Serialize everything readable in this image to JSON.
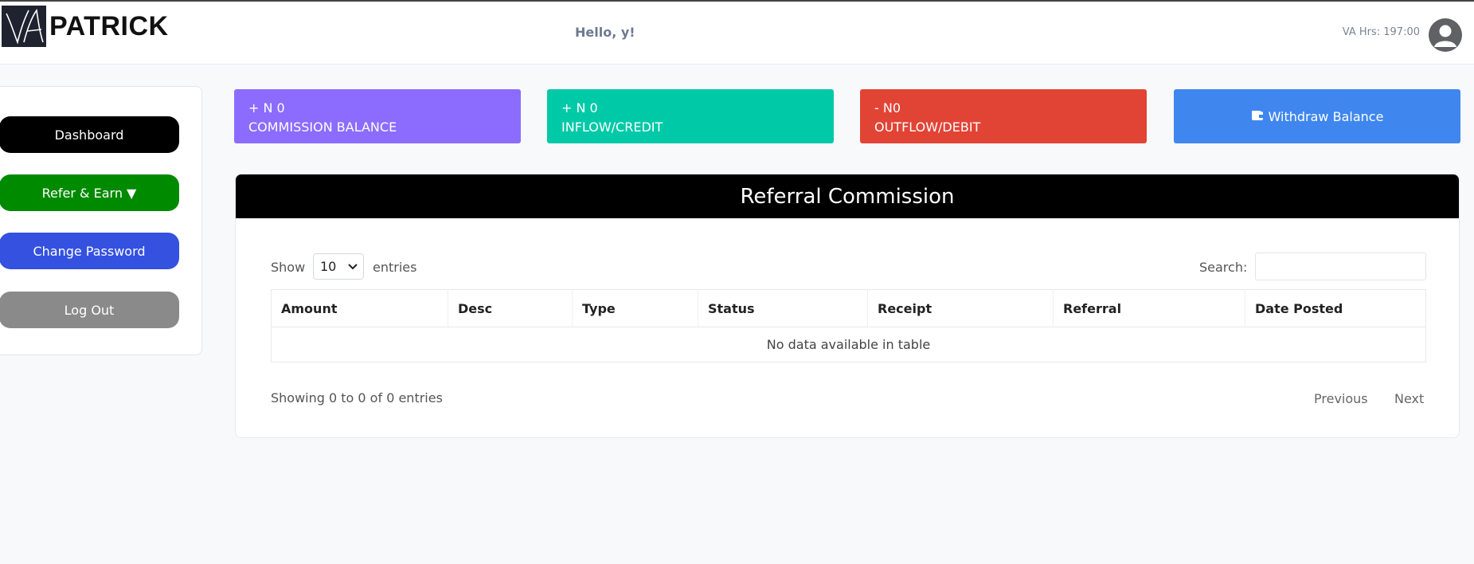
{
  "header": {
    "brand": "PATRICK",
    "logo_text": "VA",
    "greeting": "Hello, y!",
    "va_hours": "VA Hrs: 197:00",
    "avatar_icon": "user-avatar-icon"
  },
  "sidebar": {
    "items": [
      {
        "label": "Dashboard",
        "color": "#000000"
      },
      {
        "label": "Refer & Earn ▼",
        "color": "#008a00"
      },
      {
        "label": "Change Password",
        "color": "#3451e0"
      },
      {
        "label": "Log Out",
        "color": "#8a8a8a"
      }
    ]
  },
  "stats": [
    {
      "value": "+ N 0",
      "label": "COMMISSION BALANCE",
      "color": "#8b6cff"
    },
    {
      "value": "+ N 0",
      "label": "INFLOW/CREDIT",
      "color": "#00c9a7"
    },
    {
      "value": "- N0",
      "label": "OUTFLOW/DEBIT",
      "color": "#e14435"
    }
  ],
  "withdraw": {
    "label": "Withdraw Balance",
    "icon": "wallet-icon",
    "color": "#3f87ef"
  },
  "panel": {
    "title": "Referral Commission",
    "show_label": "Show",
    "entries_value": "10",
    "entries_label": "entries",
    "search_label": "Search:",
    "search_value": "",
    "columns": [
      "Amount",
      "Desc",
      "Type",
      "Status",
      "Receipt",
      "Referral",
      "Date Posted"
    ],
    "empty_message": "No data available in table",
    "info": "Showing 0 to 0 of 0 entries",
    "previous": "Previous",
    "next": "Next"
  }
}
